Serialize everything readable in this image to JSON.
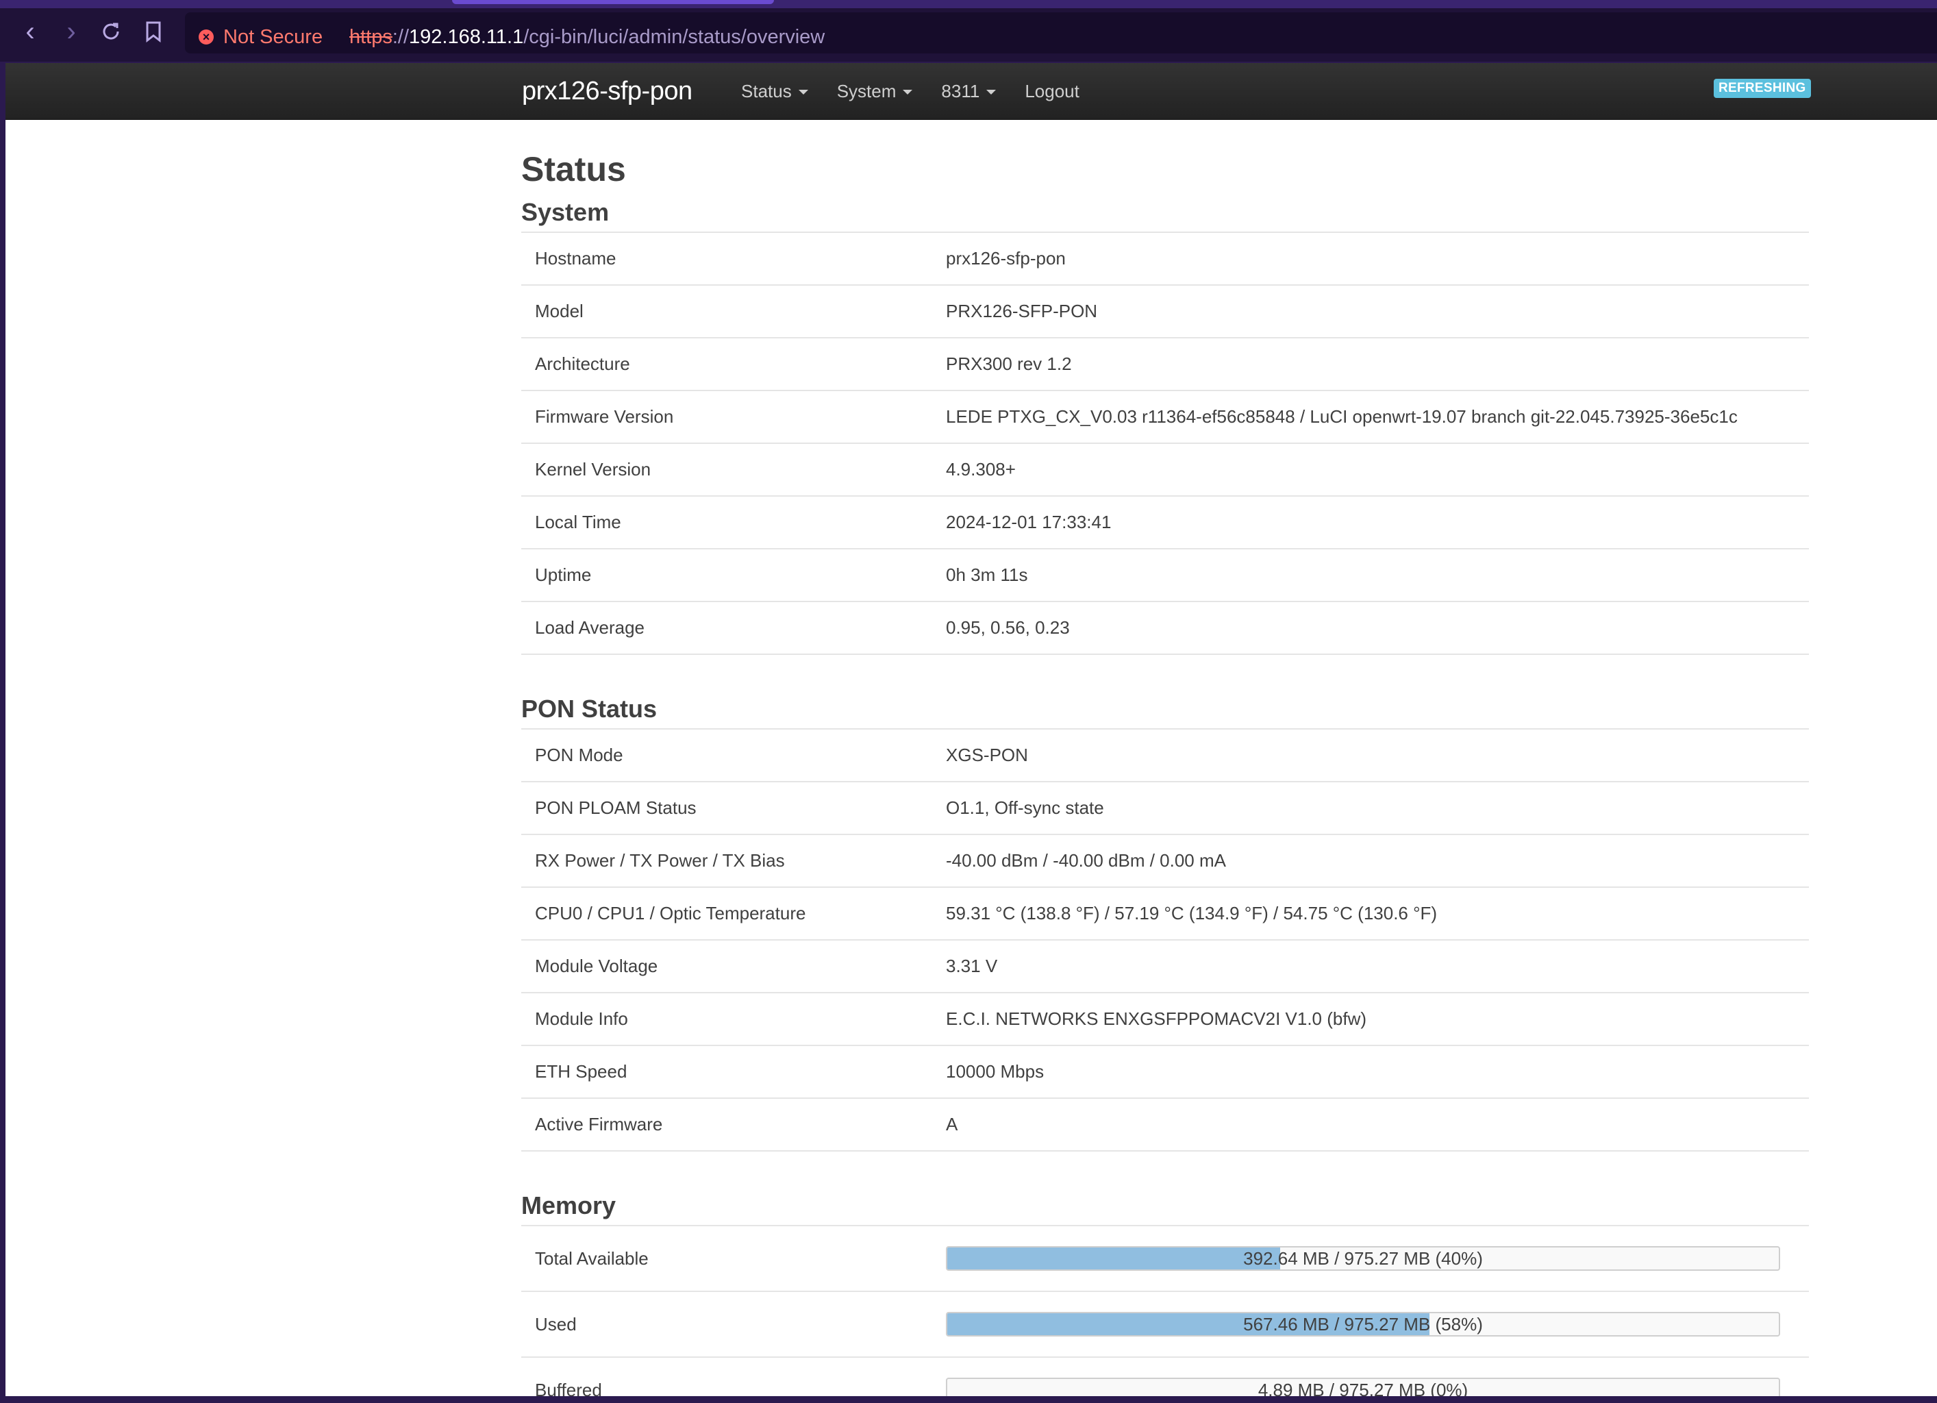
{
  "browser": {
    "security_label": "Not Secure",
    "url_scheme": "https",
    "url_sep": "://",
    "url_host": "192.168.11.1",
    "url_path": "/cgi-bin/luci/admin/status/overview"
  },
  "nav": {
    "brand": "prx126-sfp-pon",
    "menu": [
      "Status",
      "System",
      "8311",
      "Logout"
    ],
    "badge": "REFRESHING"
  },
  "page_title": "Status",
  "system": {
    "title": "System",
    "rows": [
      {
        "key": "Hostname",
        "value": "prx126-sfp-pon"
      },
      {
        "key": "Model",
        "value": "PRX126-SFP-PON"
      },
      {
        "key": "Architecture",
        "value": "PRX300 rev 1.2"
      },
      {
        "key": "Firmware Version",
        "value": "LEDE PTXG_CX_V0.03 r11364-ef56c85848 / LuCI openwrt-19.07 branch git-22.045.73925-36e5c1c"
      },
      {
        "key": "Kernel Version",
        "value": "4.9.308+"
      },
      {
        "key": "Local Time",
        "value": "2024-12-01 17:33:41"
      },
      {
        "key": "Uptime",
        "value": "0h 3m 11s"
      },
      {
        "key": "Load Average",
        "value": "0.95, 0.56, 0.23"
      }
    ]
  },
  "pon": {
    "title": "PON Status",
    "rows": [
      {
        "key": "PON Mode",
        "value": "XGS-PON"
      },
      {
        "key": "PON PLOAM Status",
        "value": "O1.1, Off-sync state"
      },
      {
        "key": "RX Power / TX Power / TX Bias",
        "value": "-40.00 dBm / -40.00 dBm / 0.00 mA"
      },
      {
        "key": "CPU0 / CPU1 / Optic Temperature",
        "value": "59.31 °C (138.8 °F) / 57.19 °C (134.9 °F) / 54.75 °C (130.6 °F)"
      },
      {
        "key": "Module Voltage",
        "value": "3.31 V"
      },
      {
        "key": "Module Info",
        "value": "E.C.I. NETWORKS ENXGSFPPOMACV2I V1.0 (bfw)"
      },
      {
        "key": "ETH Speed",
        "value": "10000 Mbps"
      },
      {
        "key": "Active Firmware",
        "value": "A"
      }
    ]
  },
  "memory": {
    "title": "Memory",
    "rows": [
      {
        "key": "Total Available",
        "text": "392.64 MB / 975.27 MB (40%)",
        "fraction": 0.4
      },
      {
        "key": "Used",
        "text": "567.46 MB / 975.27 MB (58%)",
        "fraction": 0.58
      },
      {
        "key": "Buffered",
        "text": "4.89 MB / 975.27 MB (0%)",
        "fraction": 0.0
      }
    ]
  },
  "colors": {
    "bar_fill": "#90bee0",
    "badge": "#5bc0de",
    "warning": "#ff7a6e"
  }
}
